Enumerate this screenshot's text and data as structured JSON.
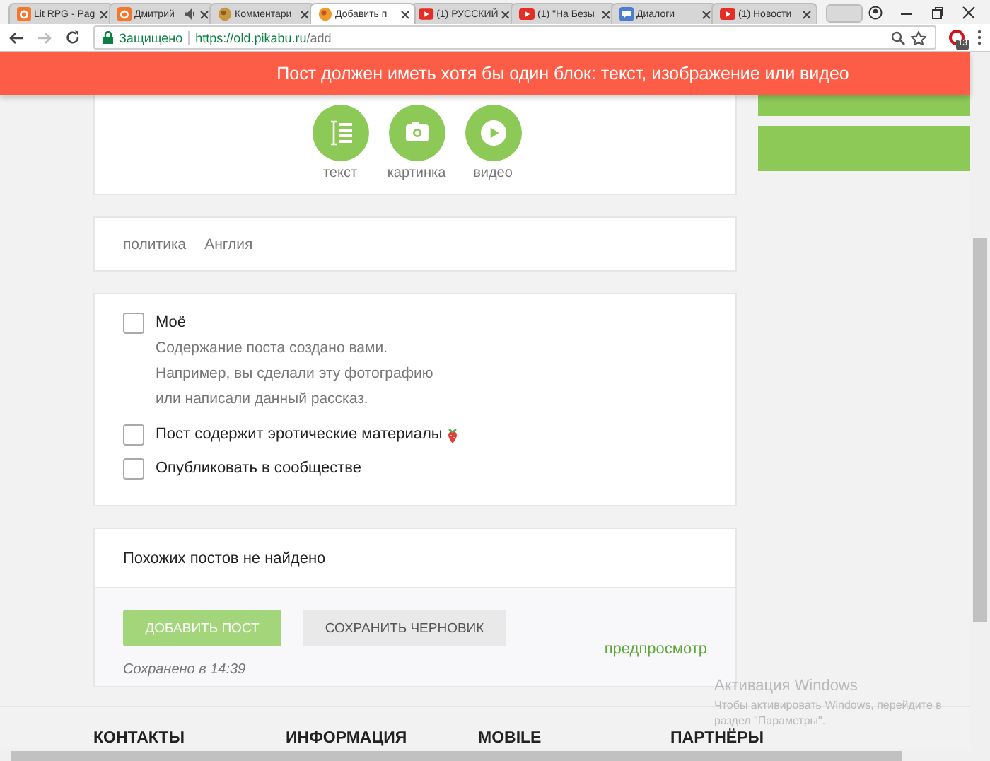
{
  "browser": {
    "tabs": [
      {
        "title": "Lit RPG - Pag",
        "kind": "pikabu",
        "selected": false,
        "audio": false
      },
      {
        "title": "Дмитрий",
        "kind": "pikabu",
        "selected": false,
        "audio": true
      },
      {
        "title": "Комментари",
        "kind": "comments",
        "selected": false,
        "audio": false
      },
      {
        "title": "Добавить п",
        "kind": "current",
        "selected": true,
        "audio": false
      },
      {
        "title": "(1) РУССКИЙ",
        "kind": "youtube",
        "selected": false,
        "audio": false
      },
      {
        "title": "(1) \"На Безы",
        "kind": "youtube",
        "selected": false,
        "audio": false
      },
      {
        "title": "Диалоги",
        "kind": "dialogs",
        "selected": false,
        "audio": false
      },
      {
        "title": "(1) Новости",
        "kind": "youtube",
        "selected": false,
        "audio": false
      }
    ],
    "address": {
      "secure_label": "Защищено",
      "url_host": "https://old.pikabu.ru",
      "url_path": "/add"
    },
    "extension_badge": "13"
  },
  "alert": "Пост должен иметь хотя бы один блок: текст, изображение или видео",
  "block_types": [
    {
      "label": "текст",
      "kind": "text"
    },
    {
      "label": "картинка",
      "kind": "image"
    },
    {
      "label": "видео",
      "kind": "video"
    }
  ],
  "tags": [
    "политика",
    "Англия"
  ],
  "options": [
    {
      "label": "Моё",
      "kind": "plain",
      "checked": false,
      "description": [
        "Содержание поста создано вами.",
        "Например, вы сделали эту фотографию",
        "или написали данный рассказ."
      ]
    },
    {
      "label": "Пост содержит эротические материалы",
      "kind": "adult",
      "checked": false
    },
    {
      "label": "Опубликовать в сообществе",
      "kind": "plain",
      "checked": false
    }
  ],
  "similar": "Похожих постов не найдено",
  "actions": {
    "publish": "ДОБАВИТЬ ПОСТ",
    "draft": "СОХРАНИТЬ ЧЕРНОВИК",
    "saved": "Сохранено в 14:39",
    "preview": "предпросмотр"
  },
  "footer": [
    "КОНТАКТЫ",
    "ИНФОРМАЦИЯ",
    "MOBILE",
    "ПАРТНЁРЫ"
  ],
  "os_notice": {
    "title": "Активация Windows",
    "text": "Чтобы активировать Windows, перейдите в раздел \"Параметры\"."
  }
}
